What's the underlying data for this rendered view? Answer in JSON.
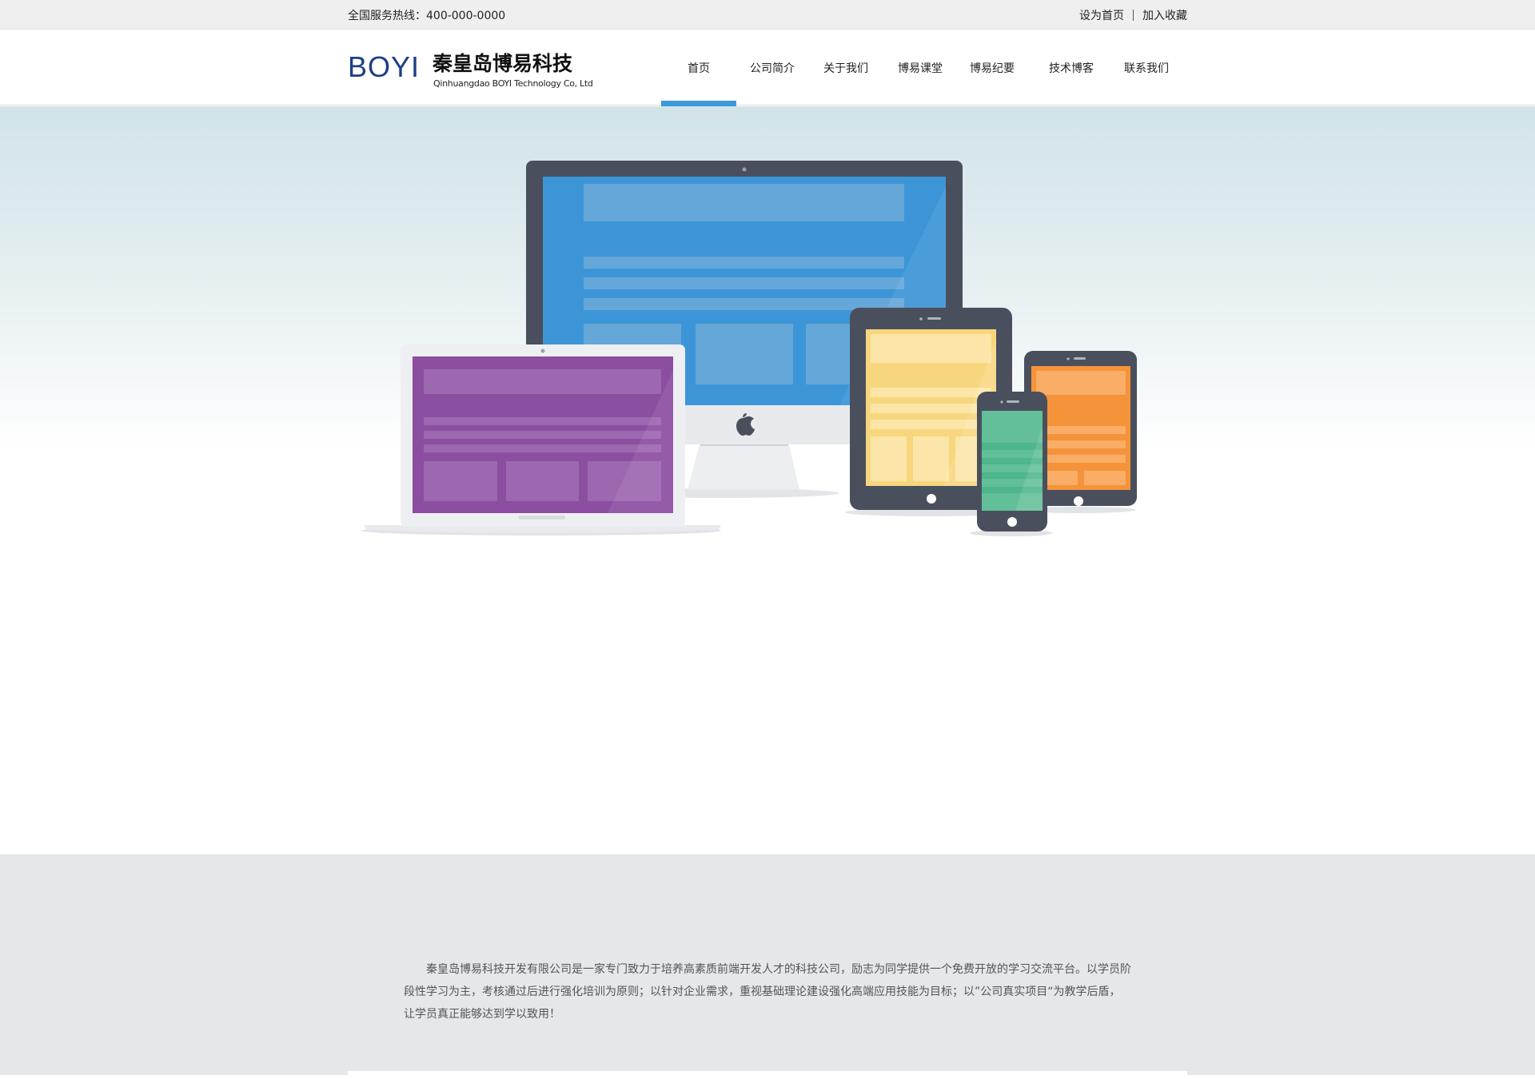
{
  "topbar": {
    "hotline": "全国服务热线：400-000-0000",
    "set_homepage": "设为首页",
    "add_favorite": "加入收藏"
  },
  "logo": {
    "mark": "BOYI",
    "name_cn": "秦皇岛博易科技",
    "name_en": "Qinhuangdao BOYI Technology Co, Ltd"
  },
  "nav": {
    "items": [
      {
        "label": "首页",
        "active": true
      },
      {
        "label": "公司简介"
      },
      {
        "label": "关于我们"
      },
      {
        "label": "博易课堂"
      },
      {
        "label": "博易纪要"
      },
      {
        "label": "技术博客"
      },
      {
        "label": "联系我们"
      }
    ]
  },
  "hero": {
    "illustration": "responsive-devices-illustration"
  },
  "about": {
    "text": "秦皇岛博易科技开发有限公司是一家专门致力于培养高素质前端开发人才的科技公司，励志为同学提供一个免费开放的学习交流平台。以学员阶段性学习为主，考核通过后进行强化培训为原则；以针对企业需求，重视基础理论建设强化高端应用技能为目标；以”公司真实项目“为教学后盾，让学员真正能够达到学以致用！"
  },
  "colors": {
    "accent": "#3b9ad9",
    "logo_blue": "#1d3f86",
    "topbar_bg": "#efefef",
    "about_bg": "#e6e7e9"
  }
}
